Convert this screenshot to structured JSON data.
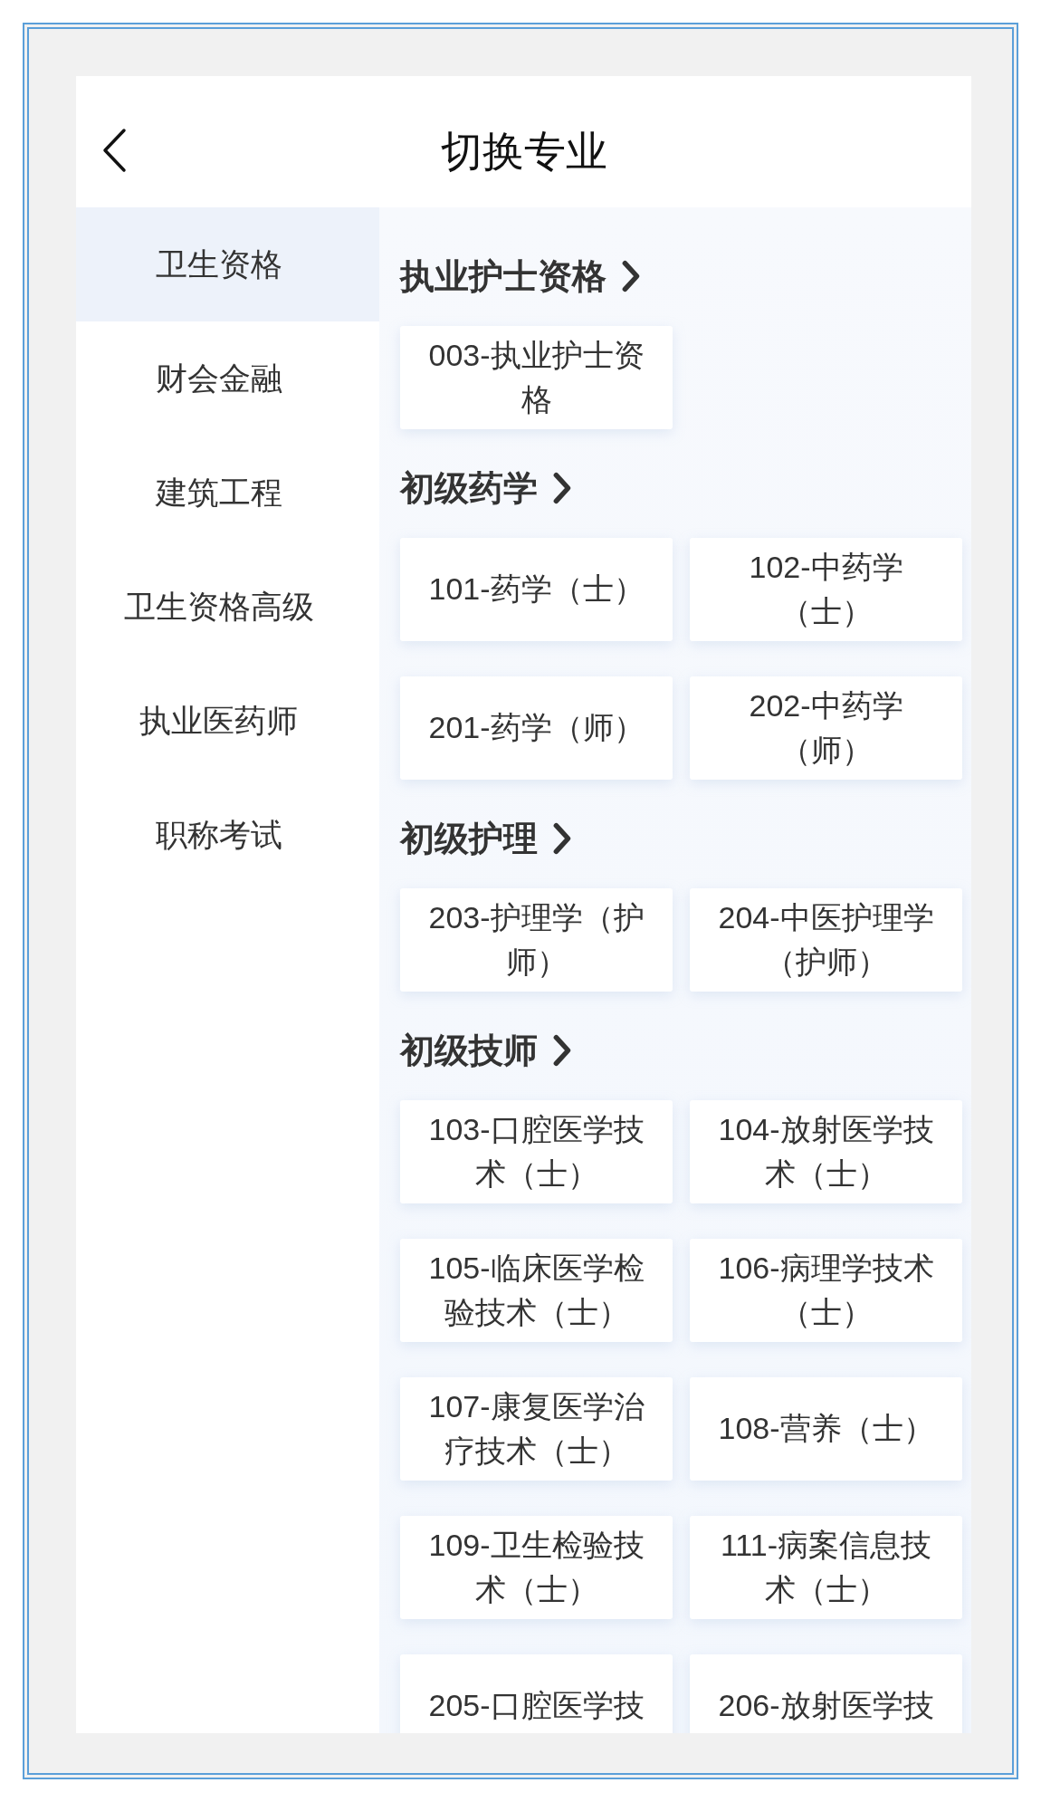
{
  "header": {
    "title": "切换专业"
  },
  "sidebar": {
    "items": [
      {
        "label": "卫生资格",
        "selected": true
      },
      {
        "label": "财会金融",
        "selected": false
      },
      {
        "label": "建筑工程",
        "selected": false
      },
      {
        "label": "卫生资格高级",
        "selected": false
      },
      {
        "label": "执业医药师",
        "selected": false
      },
      {
        "label": "职称考试",
        "selected": false
      }
    ]
  },
  "sections": [
    {
      "title": "执业护士资格",
      "items": [
        {
          "lines": [
            "003-执业护士资",
            "格"
          ]
        }
      ]
    },
    {
      "title": "初级药学",
      "items": [
        {
          "lines": [
            "101-药学（士）"
          ]
        },
        {
          "lines": [
            "102-中药学",
            "（士）"
          ]
        },
        {
          "lines": [
            "201-药学（师）"
          ]
        },
        {
          "lines": [
            "202-中药学",
            "（师）"
          ]
        }
      ]
    },
    {
      "title": "初级护理",
      "items": [
        {
          "lines": [
            "203-护理学（护",
            "师）"
          ]
        },
        {
          "lines": [
            "204-中医护理学",
            "（护师）"
          ]
        }
      ]
    },
    {
      "title": "初级技师",
      "items": [
        {
          "lines": [
            "103-口腔医学技",
            "术（士）"
          ]
        },
        {
          "lines": [
            "104-放射医学技",
            "术（士）"
          ]
        },
        {
          "lines": [
            "105-临床医学检",
            "验技术（士）"
          ]
        },
        {
          "lines": [
            "106-病理学技术",
            "（士）"
          ]
        },
        {
          "lines": [
            "107-康复医学治",
            "疗技术（士）"
          ]
        },
        {
          "lines": [
            "108-营养（士）"
          ]
        },
        {
          "lines": [
            "109-卫生检验技",
            "术（士）"
          ]
        },
        {
          "lines": [
            "111-病案信息技",
            "术（士）"
          ]
        },
        {
          "lines": [
            "205-口腔医学技"
          ]
        },
        {
          "lines": [
            "206-放射医学技"
          ]
        }
      ]
    }
  ]
}
